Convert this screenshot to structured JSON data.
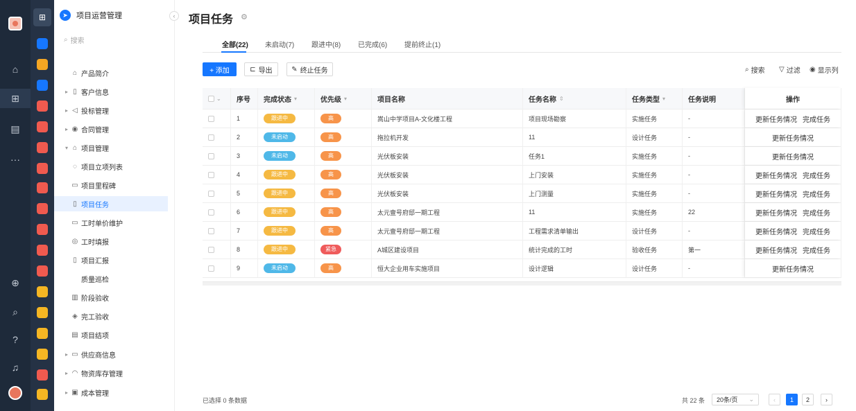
{
  "rail": {
    "icons": [
      "home-icon",
      "apps-grid-icon",
      "document-icon",
      "more-icon",
      "add-circle-icon",
      "search-icon",
      "help-icon",
      "bell-icon"
    ],
    "glyphs": [
      "⌂",
      "⊞",
      "▤",
      "···",
      "⊕",
      "⌕",
      "?",
      "♫"
    ]
  },
  "apps": {
    "colors": [
      "#1677ff",
      "#f5a623",
      "#1677ff",
      "#f05a4f",
      "#f05a4f",
      "#f05a4f",
      "#f05a4f",
      "#f05a4f",
      "#f05a4f",
      "#f05a4f",
      "#f05a4f",
      "#f05a4f",
      "#f5b623",
      "#f5b623",
      "#f5b623",
      "#f5b623",
      "#f05a4f",
      "#f5b623",
      "#3bb36b"
    ]
  },
  "sidebar": {
    "title": "项目运营管理",
    "search_placeholder": "搜索",
    "items": [
      {
        "label": "产品简介",
        "icon": "⌂",
        "caret": ""
      },
      {
        "label": "客户信息",
        "icon": "▯",
        "caret": "▸"
      },
      {
        "label": "投标管理",
        "icon": "◁",
        "caret": "▸"
      },
      {
        "label": "合同管理",
        "icon": "◉",
        "caret": "▸"
      },
      {
        "label": "项目管理",
        "icon": "⌂",
        "caret": "▾"
      },
      {
        "label": "项目立项列表",
        "icon": "◌",
        "caret": ""
      },
      {
        "label": "项目里程碑",
        "icon": "▭",
        "caret": ""
      },
      {
        "label": "项目任务",
        "icon": "▯",
        "caret": ""
      },
      {
        "label": "工时单价维护",
        "icon": "▭",
        "caret": ""
      },
      {
        "label": "工时填报",
        "icon": "◎",
        "caret": ""
      },
      {
        "label": "项目汇报",
        "icon": "▯",
        "caret": ""
      },
      {
        "label": "质量巡检",
        "icon": "",
        "caret": ""
      },
      {
        "label": "阶段验收",
        "icon": "▥",
        "caret": ""
      },
      {
        "label": "完工验收",
        "icon": "◈",
        "caret": ""
      },
      {
        "label": "项目结项",
        "icon": "▤",
        "caret": ""
      },
      {
        "label": "供应商信息",
        "icon": "▭",
        "caret": "▸"
      },
      {
        "label": "物资库存管理",
        "icon": "◠",
        "caret": "▸"
      },
      {
        "label": "成本管理",
        "icon": "▣",
        "caret": "▸"
      }
    ]
  },
  "header": {
    "title": "项目任务",
    "gear": "⚙"
  },
  "tabs": [
    "全部(22)",
    "未启动(7)",
    "跟进中(8)",
    "已完成(6)",
    "提前终止(1)"
  ],
  "toolbar": {
    "add": "+ 添加",
    "export": "导出",
    "terminate": "终止任务",
    "search": "搜索",
    "filter": "过滤",
    "columns": "显示列"
  },
  "colors": {
    "followup": "#f5b942",
    "notstarted": "#4fb8e8",
    "high": "#f7944a",
    "urgent": "#ef5b5b"
  },
  "table": {
    "headers": {
      "index": "序号",
      "status": "完成状态",
      "priority": "优先级",
      "project": "项目名称",
      "task": "任务名称",
      "type": "任务类型",
      "desc": "任务说明",
      "ops": "操作"
    },
    "rows": [
      {
        "index": "1",
        "status": "跟进中",
        "statusKey": "followup",
        "priority": "高",
        "priorityKey": "high",
        "project": "嵩山中学项目A-文化楼工程",
        "task": "项目现场勘察",
        "type": "实施任务",
        "desc": "-",
        "ops": [
          "更新任务情况",
          "完成任务"
        ]
      },
      {
        "index": "2",
        "status": "未启动",
        "statusKey": "notstarted",
        "priority": "高",
        "priorityKey": "high",
        "project": "拖拉机开发",
        "task": "11",
        "type": "设计任务",
        "desc": "-",
        "ops": [
          "更新任务情况"
        ]
      },
      {
        "index": "3",
        "status": "未启动",
        "statusKey": "notstarted",
        "priority": "高",
        "priorityKey": "high",
        "project": "光伏板安装",
        "task": "任务1",
        "type": "实施任务",
        "desc": "-",
        "ops": [
          "更新任务情况"
        ]
      },
      {
        "index": "4",
        "status": "跟进中",
        "statusKey": "followup",
        "priority": "高",
        "priorityKey": "high",
        "project": "光伏板安装",
        "task": "上门安装",
        "type": "实施任务",
        "desc": "-",
        "ops": [
          "更新任务情况",
          "完成任务"
        ]
      },
      {
        "index": "5",
        "status": "跟进中",
        "statusKey": "followup",
        "priority": "高",
        "priorityKey": "high",
        "project": "光伏板安装",
        "task": "上门测量",
        "type": "实施任务",
        "desc": "-",
        "ops": [
          "更新任务情况",
          "完成任务"
        ]
      },
      {
        "index": "6",
        "status": "跟进中",
        "statusKey": "followup",
        "priority": "高",
        "priorityKey": "high",
        "project": "太元壹号府邸一期工程",
        "task": "11",
        "type": "实施任务",
        "desc": "22",
        "ops": [
          "更新任务情况",
          "完成任务"
        ]
      },
      {
        "index": "7",
        "status": "跟进中",
        "statusKey": "followup",
        "priority": "高",
        "priorityKey": "high",
        "project": "太元壹号府邸一期工程",
        "task": "工程需求清单输出",
        "type": "设计任务",
        "desc": "-",
        "ops": [
          "更新任务情况",
          "完成任务"
        ]
      },
      {
        "index": "8",
        "status": "跟进中",
        "statusKey": "followup",
        "priority": "紧急",
        "priorityKey": "urgent",
        "project": "A城区建设项目",
        "task": "统计完成的工时",
        "type": "验收任务",
        "desc": "第一",
        "ops": [
          "更新任务情况",
          "完成任务"
        ]
      },
      {
        "index": "9",
        "status": "未启动",
        "statusKey": "notstarted",
        "priority": "高",
        "priorityKey": "high",
        "project": "恒大企业用车实施项目",
        "task": "设计逻辑",
        "type": "设计任务",
        "desc": "-",
        "ops": [
          "更新任务情况"
        ]
      }
    ]
  },
  "footer": {
    "selected": "已选择 0 条数据",
    "total": "共 22 条",
    "page_size": "20条/页",
    "pages": [
      "1",
      "2"
    ],
    "prev": "‹",
    "next": "›"
  }
}
